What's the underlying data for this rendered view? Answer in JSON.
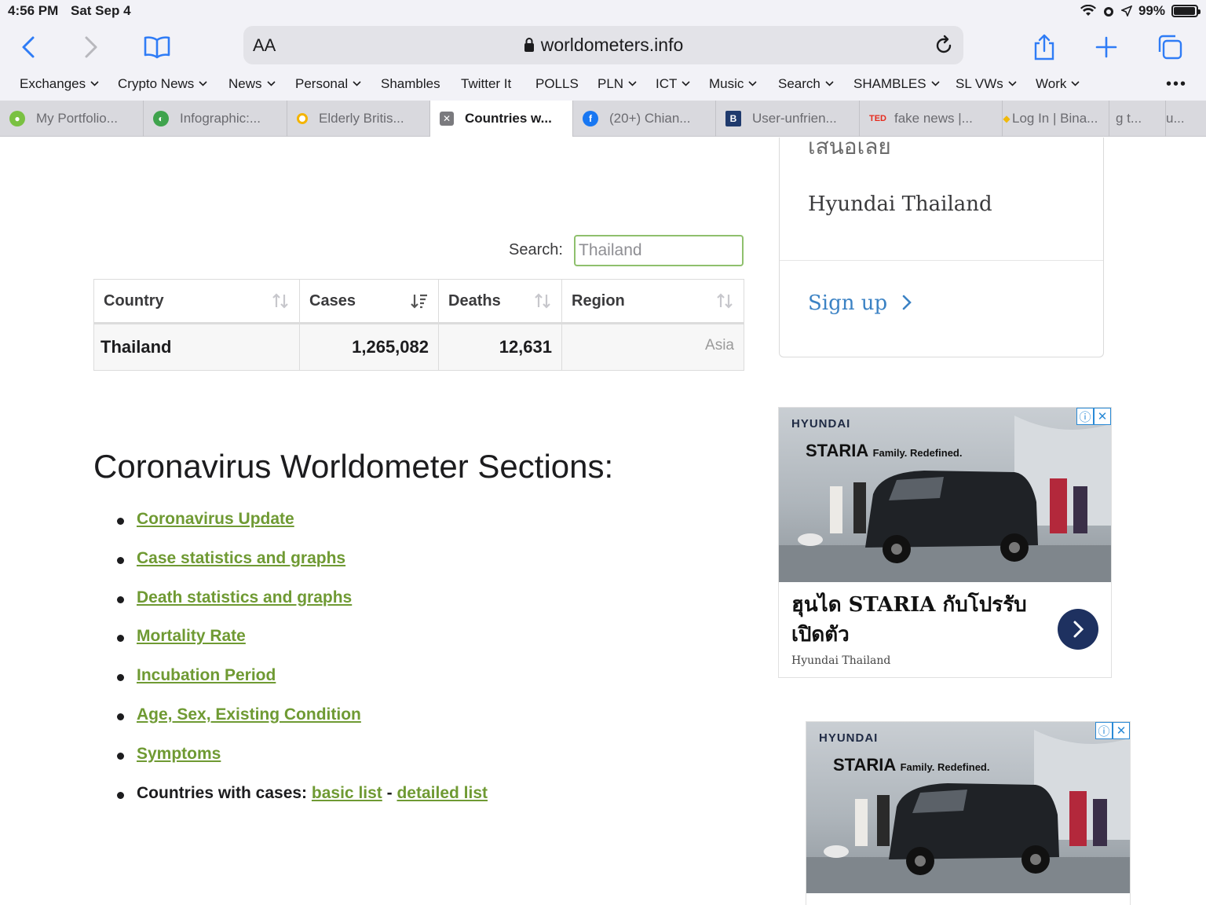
{
  "status_bar": {
    "time": "4:56 PM",
    "date": "Sat Sep 4",
    "battery": "99%"
  },
  "toolbar": {
    "text_size_label": "AA",
    "url": "worldometers.info"
  },
  "bookmarks": [
    {
      "label": "Exchanges",
      "menu": true
    },
    {
      "label": "Crypto News",
      "menu": true
    },
    {
      "label": "News",
      "menu": true
    },
    {
      "label": "Personal",
      "menu": true
    },
    {
      "label": "Shambles",
      "menu": false
    },
    {
      "label": "Twitter It",
      "menu": false
    },
    {
      "label": "POLLS",
      "menu": false
    },
    {
      "label": "PLN",
      "menu": true
    },
    {
      "label": "ICT",
      "menu": true
    },
    {
      "label": "Music",
      "menu": true
    },
    {
      "label": "Search",
      "menu": true
    },
    {
      "label": "SHAMBLES",
      "menu": true
    },
    {
      "label": "SL VWs",
      "menu": true
    },
    {
      "label": "Work",
      "menu": true
    }
  ],
  "tabs": [
    {
      "label": "My Portfolio...",
      "icon": "portfolio-icon"
    },
    {
      "label": "Infographic:...",
      "icon": "infographic-icon"
    },
    {
      "label": "Elderly Britis...",
      "icon": "google-icon"
    },
    {
      "label": "Countries w...",
      "icon": "close-icon",
      "active": true
    },
    {
      "label": "(20+) Chian...",
      "icon": "facebook-icon"
    },
    {
      "label": "User-unfrien...",
      "icon": "b-icon"
    },
    {
      "label": "fake news |...",
      "icon": "ted-icon",
      "badge": "TED"
    },
    {
      "label": "Log In | Bina...",
      "icon": "binance-icon"
    },
    {
      "label": "g t...",
      "icon": ""
    },
    {
      "label": "u...",
      "icon": ""
    }
  ],
  "search": {
    "label": "Search:",
    "value": "Thailand"
  },
  "table": {
    "headers": [
      "Country",
      "Cases",
      "Deaths",
      "Region"
    ],
    "rows": [
      {
        "country": "Thailand",
        "cases": "1,265,082",
        "deaths": "12,631",
        "region": "Asia"
      }
    ]
  },
  "sections": {
    "title": "Coronavirus Worldometer Sections:",
    "links": [
      "Coronavirus Update",
      "Case statistics and graphs",
      "Death statistics and graphs",
      "Mortality Rate",
      "Incubation Period",
      "Age, Sex, Existing Condition",
      "Symptoms"
    ],
    "countries_label": "Countries with cases:",
    "basic_list": "basic list",
    "separator": "-",
    "detailed_list": "detailed list"
  },
  "sidebar": {
    "thai_text": "เสนอเลย",
    "brand": "Hyundai Thailand",
    "signup": "Sign up"
  },
  "ads": [
    {
      "logo": "HYUNDAI",
      "model": "STARIA",
      "tagline": "Family. Redefined.",
      "headline": "ฮุนได STARIA กับโปรรับเปิดตัว",
      "brand": "Hyundai Thailand"
    },
    {
      "logo": "HYUNDAI",
      "model": "STARIA",
      "tagline": "Family. Redefined."
    }
  ],
  "colors": {
    "accent_blue": "#2f7cf6",
    "link_green": "#6f9a33",
    "search_border": "#8fc06d",
    "ad_button": "#1e3160"
  }
}
